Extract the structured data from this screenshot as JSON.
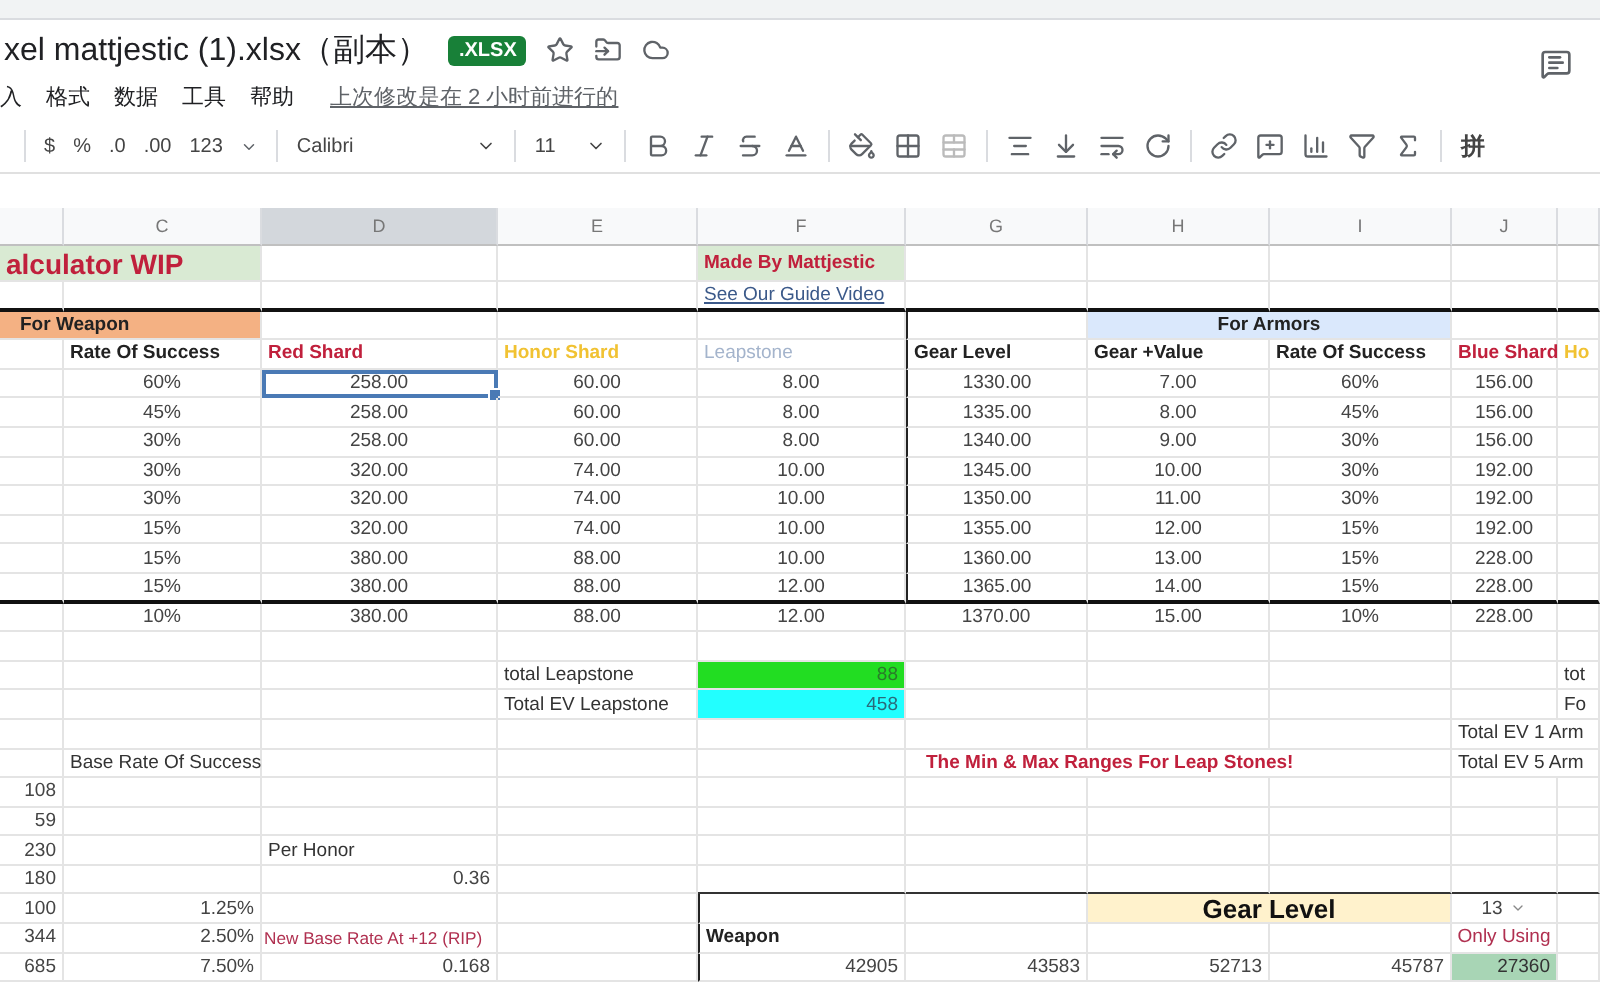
{
  "document": {
    "title": "xel mattjestic (1).xlsx（副本）",
    "badge": ".XLSX",
    "menu": [
      "入",
      "格式",
      "数据",
      "工具",
      "帮助"
    ],
    "last_edit": "上次修改是在 2 小时前进行的"
  },
  "toolbar": {
    "format_buttons": [
      "$",
      "%",
      ".0",
      ".00",
      "123"
    ],
    "font": "Calibri",
    "size": "11",
    "input_tool": "拼"
  },
  "columns": [
    {
      "selected": false
    },
    {
      "label": "C",
      "selected": false
    },
    {
      "label": "D",
      "selected": true
    },
    {
      "label": "E",
      "selected": false
    },
    {
      "label": "F",
      "selected": false
    },
    {
      "label": "G",
      "selected": false
    },
    {
      "label": "H",
      "selected": false
    },
    {
      "label": "I",
      "selected": false
    },
    {
      "label": "J",
      "selected": false
    },
    {
      "selected": false
    }
  ],
  "rows": [
    {
      "cells": [
        {
          "text": "alculator WIP",
          "kind": "title",
          "selected": false
        },
        null,
        null,
        {
          "text": "Made By Mattjestic",
          "kind": "credit",
          "selected": false
        },
        null,
        null,
        null,
        null,
        null
      ]
    },
    {
      "cells": [
        null,
        null,
        null,
        null,
        {
          "text": "See Our Guide Video",
          "kind": "link",
          "selected": false
        },
        null,
        null,
        null,
        null,
        null
      ]
    },
    {
      "cells": [
        {
          "text": "For Weapon",
          "kind": "section-orange",
          "selected": false
        },
        null,
        null,
        null,
        null,
        {
          "text": "For Armors",
          "kind": "section-blue",
          "selected": false
        },
        null,
        null
      ]
    },
    {
      "cells": [
        null,
        {
          "text": "Rate Of Success",
          "kind": "head",
          "selected": false
        },
        {
          "text": "Red Shard",
          "kind": "head-red",
          "selected": false
        },
        {
          "text": "Honor Shard",
          "kind": "head-yellow",
          "selected": false
        },
        {
          "text": "Leapstone",
          "kind": "head-grey",
          "selected": false
        },
        {
          "text": "Gear Level",
          "kind": "head",
          "selected": false
        },
        {
          "text": "Gear +Value",
          "kind": "head",
          "selected": false
        },
        {
          "text": "Rate Of Success",
          "kind": "head",
          "selected": false
        },
        {
          "text": "Blue Shard",
          "kind": "head-red",
          "selected": false
        },
        {
          "text": "Ho",
          "kind": "head-yellow",
          "selected": false
        }
      ]
    },
    {
      "cells": [
        null,
        {
          "text": "60%",
          "kind": "num",
          "selected": false
        },
        {
          "text": "258.00",
          "kind": "num",
          "selected": true
        },
        {
          "text": "60.00",
          "kind": "num",
          "selected": false
        },
        {
          "text": "8.00",
          "kind": "num",
          "selected": false
        },
        {
          "text": "1330.00",
          "kind": "num",
          "selected": false
        },
        {
          "text": "7.00",
          "kind": "num",
          "selected": false
        },
        {
          "text": "60%",
          "kind": "num",
          "selected": false
        },
        {
          "text": "156.00",
          "kind": "num",
          "selected": false
        },
        null
      ]
    },
    {
      "cells": [
        null,
        {
          "text": "45%",
          "kind": "num",
          "selected": false
        },
        {
          "text": "258.00",
          "kind": "num",
          "selected": false
        },
        {
          "text": "60.00",
          "kind": "num",
          "selected": false
        },
        {
          "text": "8.00",
          "kind": "num",
          "selected": false
        },
        {
          "text": "1335.00",
          "kind": "num",
          "selected": false
        },
        {
          "text": "8.00",
          "kind": "num",
          "selected": false
        },
        {
          "text": "45%",
          "kind": "num",
          "selected": false
        },
        {
          "text": "156.00",
          "kind": "num",
          "selected": false
        },
        null
      ]
    },
    {
      "cells": [
        null,
        {
          "text": "30%",
          "kind": "num",
          "selected": false
        },
        {
          "text": "258.00",
          "kind": "num",
          "selected": false
        },
        {
          "text": "60.00",
          "kind": "num",
          "selected": false
        },
        {
          "text": "8.00",
          "kind": "num",
          "selected": false
        },
        {
          "text": "1340.00",
          "kind": "num",
          "selected": false
        },
        {
          "text": "9.00",
          "kind": "num",
          "selected": false
        },
        {
          "text": "30%",
          "kind": "num",
          "selected": false
        },
        {
          "text": "156.00",
          "kind": "num",
          "selected": false
        },
        null
      ]
    },
    {
      "cells": [
        null,
        {
          "text": "30%",
          "kind": "num",
          "selected": false
        },
        {
          "text": "320.00",
          "kind": "num",
          "selected": false
        },
        {
          "text": "74.00",
          "kind": "num",
          "selected": false
        },
        {
          "text": "10.00",
          "kind": "num",
          "selected": false
        },
        {
          "text": "1345.00",
          "kind": "num",
          "selected": false
        },
        {
          "text": "10.00",
          "kind": "num",
          "selected": false
        },
        {
          "text": "30%",
          "kind": "num",
          "selected": false
        },
        {
          "text": "192.00",
          "kind": "num",
          "selected": false
        },
        null
      ]
    },
    {
      "cells": [
        null,
        {
          "text": "30%",
          "kind": "num",
          "selected": false
        },
        {
          "text": "320.00",
          "kind": "num",
          "selected": false
        },
        {
          "text": "74.00",
          "kind": "num",
          "selected": false
        },
        {
          "text": "10.00",
          "kind": "num",
          "selected": false
        },
        {
          "text": "1350.00",
          "kind": "num",
          "selected": false
        },
        {
          "text": "11.00",
          "kind": "num",
          "selected": false
        },
        {
          "text": "30%",
          "kind": "num",
          "selected": false
        },
        {
          "text": "192.00",
          "kind": "num",
          "selected": false
        },
        null
      ]
    },
    {
      "cells": [
        null,
        {
          "text": "15%",
          "kind": "num",
          "selected": false
        },
        {
          "text": "320.00",
          "kind": "num",
          "selected": false
        },
        {
          "text": "74.00",
          "kind": "num",
          "selected": false
        },
        {
          "text": "10.00",
          "kind": "num",
          "selected": false
        },
        {
          "text": "1355.00",
          "kind": "num",
          "selected": false
        },
        {
          "text": "12.00",
          "kind": "num",
          "selected": false
        },
        {
          "text": "15%",
          "kind": "num",
          "selected": false
        },
        {
          "text": "192.00",
          "kind": "num",
          "selected": false
        },
        null
      ]
    },
    {
      "cells": [
        null,
        {
          "text": "15%",
          "kind": "num",
          "selected": false
        },
        {
          "text": "380.00",
          "kind": "num",
          "selected": false
        },
        {
          "text": "88.00",
          "kind": "num",
          "selected": false
        },
        {
          "text": "10.00",
          "kind": "num",
          "selected": false
        },
        {
          "text": "1360.00",
          "kind": "num",
          "selected": false
        },
        {
          "text": "13.00",
          "kind": "num",
          "selected": false
        },
        {
          "text": "15%",
          "kind": "num",
          "selected": false
        },
        {
          "text": "228.00",
          "kind": "num",
          "selected": false
        },
        null
      ]
    },
    {
      "cells": [
        null,
        {
          "text": "15%",
          "kind": "num",
          "selected": false
        },
        {
          "text": "380.00",
          "kind": "num",
          "selected": false
        },
        {
          "text": "88.00",
          "kind": "num",
          "selected": false
        },
        {
          "text": "12.00",
          "kind": "num",
          "selected": false
        },
        {
          "text": "1365.00",
          "kind": "num",
          "selected": false
        },
        {
          "text": "14.00",
          "kind": "num",
          "selected": false
        },
        {
          "text": "15%",
          "kind": "num",
          "selected": false
        },
        {
          "text": "228.00",
          "kind": "num",
          "selected": false
        },
        null
      ]
    },
    {
      "cells": [
        null,
        {
          "text": "10%",
          "kind": "num",
          "selected": false
        },
        {
          "text": "380.00",
          "kind": "num",
          "selected": false
        },
        {
          "text": "88.00",
          "kind": "num",
          "selected": false
        },
        {
          "text": "12.00",
          "kind": "num",
          "selected": false
        },
        {
          "text": "1370.00",
          "kind": "num",
          "selected": false
        },
        {
          "text": "15.00",
          "kind": "num",
          "selected": false
        },
        {
          "text": "10%",
          "kind": "num",
          "selected": false
        },
        {
          "text": "228.00",
          "kind": "num",
          "selected": false
        },
        null
      ]
    },
    {
      "cells": [
        null,
        null,
        null,
        null,
        null,
        null,
        null,
        null,
        null,
        null
      ]
    },
    {
      "cells": [
        null,
        null,
        null,
        {
          "text": "total Leapstone",
          "kind": "text",
          "selected": false
        },
        {
          "text": "88",
          "kind": "total-green",
          "selected": false
        },
        null,
        null,
        null,
        null,
        {
          "text": "tot",
          "kind": "text",
          "selected": false
        }
      ]
    },
    {
      "cells": [
        null,
        null,
        null,
        {
          "text": "Total EV Leapstone",
          "kind": "text",
          "selected": false
        },
        {
          "text": "458",
          "kind": "total-cyan",
          "selected": false
        },
        null,
        null,
        null,
        null,
        {
          "text": "Fo",
          "kind": "text",
          "selected": false
        }
      ]
    },
    {
      "cells": [
        null,
        null,
        null,
        null,
        null,
        null,
        null,
        null,
        {
          "text": "Total EV 1 Arm",
          "kind": "text-wide",
          "selected": false
        }
      ]
    },
    {
      "cells": [
        null,
        {
          "text": "Base Rate Of Success",
          "kind": "text",
          "selected": false
        },
        null,
        null,
        null,
        {
          "text": "The Min & Max Ranges For Leap Stones!",
          "kind": "banner-red",
          "selected": false
        },
        {
          "text": "Total EV 5 Arm",
          "kind": "text-wide",
          "selected": false
        }
      ]
    },
    {
      "cells": [
        {
          "text": "108",
          "kind": "num-right",
          "selected": false
        },
        null,
        null,
        null,
        null,
        null,
        null,
        null,
        null,
        null
      ]
    },
    {
      "cells": [
        {
          "text": "59",
          "kind": "num-right",
          "selected": false
        },
        null,
        null,
        null,
        null,
        null,
        null,
        null,
        null,
        null
      ]
    },
    {
      "cells": [
        {
          "text": "230",
          "kind": "num-right",
          "selected": false
        },
        null,
        {
          "text": "Per Honor",
          "kind": "text",
          "selected": false
        },
        null,
        null,
        null,
        null,
        null,
        null,
        null
      ]
    },
    {
      "cells": [
        {
          "text": "180",
          "kind": "num-right",
          "selected": false
        },
        null,
        {
          "text": "0.36",
          "kind": "num-right",
          "selected": false
        },
        null,
        null,
        null,
        null,
        null,
        null,
        null
      ]
    },
    {
      "cells": [
        {
          "text": "100",
          "kind": "num-right",
          "selected": false
        },
        {
          "text": "1.25%",
          "kind": "num-right",
          "selected": false
        },
        null,
        null,
        null,
        null,
        {
          "text": "Gear Level",
          "kind": "gear-level",
          "selected": false
        },
        {
          "text": "13",
          "kind": "dropdown",
          "selected": false
        },
        null
      ]
    },
    {
      "cells": [
        {
          "text": "344",
          "kind": "num-right",
          "selected": false
        },
        {
          "text": "2.50%",
          "kind": "num-right",
          "selected": false
        },
        {
          "text": "New Base Rate At +12 (RIP)",
          "kind": "note-red",
          "selected": false
        },
        null,
        {
          "text": "Weapon",
          "kind": "box-head",
          "selected": false
        },
        null,
        null,
        null,
        {
          "text": "Only Using",
          "kind": "only",
          "selected": false
        },
        null
      ]
    },
    {
      "cells": [
        {
          "text": "685",
          "kind": "num-right",
          "selected": false
        },
        {
          "text": "7.50%",
          "kind": "num-right",
          "selected": false
        },
        {
          "text": "0.168",
          "kind": "num-right",
          "selected": false
        },
        null,
        {
          "text": "42905",
          "kind": "num-right",
          "selected": false
        },
        {
          "text": "43583",
          "kind": "num-right",
          "selected": false
        },
        {
          "text": "52713",
          "kind": "num-right",
          "selected": false
        },
        {
          "text": "45787",
          "kind": "num-right",
          "selected": false
        },
        {
          "text": "27360",
          "kind": "num-green",
          "selected": false
        },
        null
      ]
    }
  ]
}
